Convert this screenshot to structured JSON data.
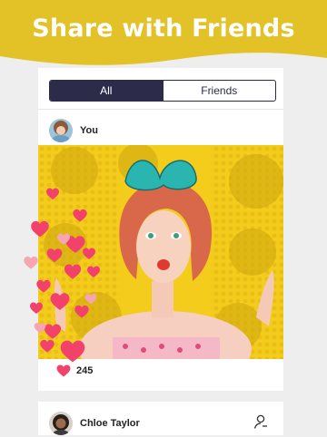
{
  "header": {
    "headline": "Share with Friends"
  },
  "tabs": [
    {
      "label": "All",
      "active": true
    },
    {
      "label": "Friends",
      "active": false
    }
  ],
  "post": {
    "author": "You",
    "likes": "245",
    "image": "pop-art-woman-with-bow"
  },
  "next_post": {
    "author": "Chloe Taylor"
  },
  "icons": {
    "like": "heart-icon",
    "follow": "add-person-icon",
    "floating": "floating-hearts"
  },
  "colors": {
    "banner": "#e2c226",
    "segment_active": "#2d2b4a",
    "heart": "#f2416b",
    "heart_light": "#f7a5b3"
  }
}
